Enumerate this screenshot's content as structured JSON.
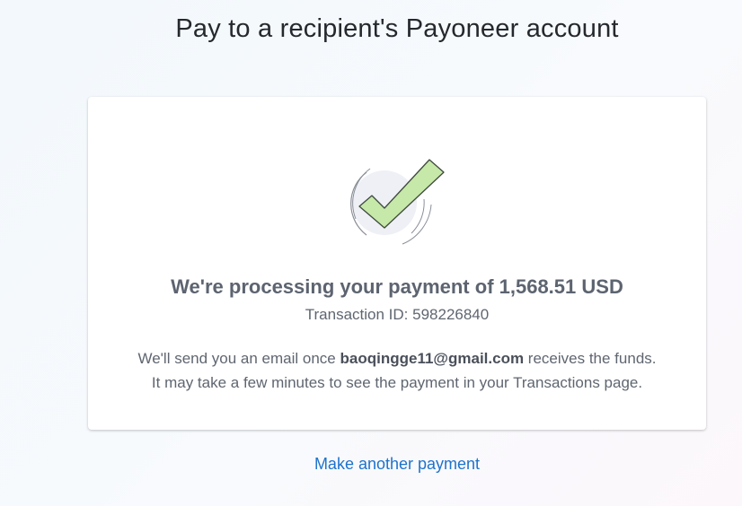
{
  "page": {
    "title": "Pay to a recipient's Payoneer account"
  },
  "confirmation": {
    "icon": "checkmark-success-icon",
    "headline": "We're processing your payment of 1,568.51 USD",
    "transaction_id_text": "Transaction ID: 598226840",
    "email_note_prefix": "We'll send you an email once ",
    "recipient_email": "baoqingge11@gmail.com",
    "email_note_suffix": " receives the funds.",
    "timing_note": "It may take a few minutes to see the payment in your Transactions page."
  },
  "actions": {
    "make_another_payment": "Make another payment"
  },
  "colors": {
    "link": "#1e73cc",
    "check_fill": "#c6e8a8",
    "text_muted": "#5f6670"
  }
}
